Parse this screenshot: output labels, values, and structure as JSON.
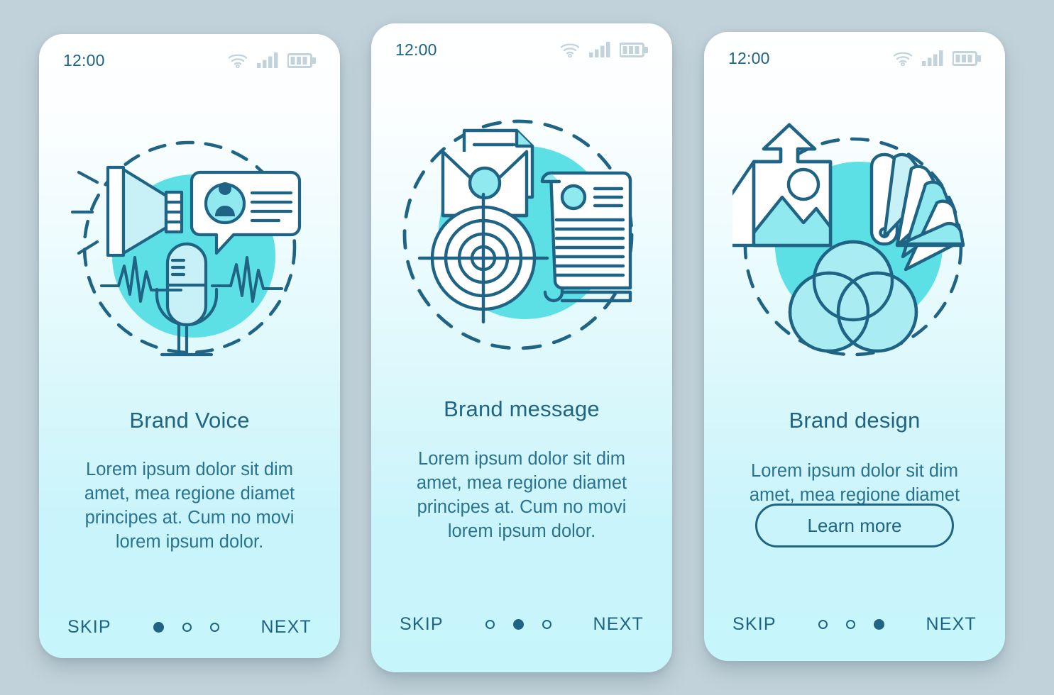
{
  "screens": [
    {
      "status": {
        "time": "12:00",
        "icons": [
          "wifi-icon",
          "signal-icon",
          "battery-icon"
        ]
      },
      "illustration": "brand-voice-illustration",
      "title": "Brand Voice",
      "description": "Lorem ipsum dolor sit dim amet, mea regione diamet principes at. Cum no movi lorem ipsum dolor.",
      "cta": null,
      "footer": {
        "skip": "SKIP",
        "next": "NEXT",
        "dots": 3,
        "active": 0
      }
    },
    {
      "status": {
        "time": "12:00",
        "icons": [
          "wifi-icon",
          "signal-icon",
          "battery-icon"
        ]
      },
      "illustration": "brand-message-illustration",
      "title": "Brand message",
      "description": "Lorem ipsum dolor sit dim amet, mea regione diamet principes at. Cum no movi lorem ipsum dolor.",
      "cta": null,
      "footer": {
        "skip": "SKIP",
        "next": "NEXT",
        "dots": 3,
        "active": 1
      }
    },
    {
      "status": {
        "time": "12:00",
        "icons": [
          "wifi-icon",
          "signal-icon",
          "battery-icon"
        ]
      },
      "illustration": "brand-design-illustration",
      "title": "Brand design",
      "description": "Lorem ipsum dolor sit dim amet, mea regione diamet",
      "cta": "Learn more",
      "footer": {
        "skip": "SKIP",
        "next": "NEXT",
        "dots": 3,
        "active": 2
      }
    }
  ],
  "colors": {
    "page_background": "#c2d2da",
    "card_top": "#ffffff",
    "card_bottom": "#c6f6fb",
    "accent_teal": "#5ce0e6",
    "outline_dark": "#1f6485",
    "text_dark": "#1f6485",
    "status_icon": "#c2d3dc",
    "fill_light": "#c7f1f6"
  }
}
